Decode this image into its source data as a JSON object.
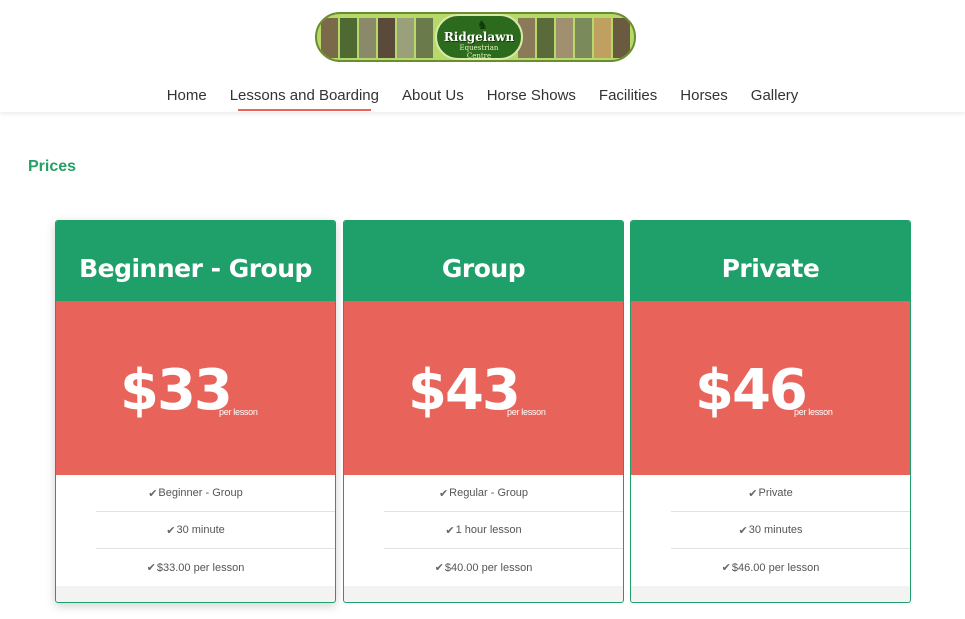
{
  "logo": {
    "name": "Ridgelawn",
    "subtitle_line1": "Equestrian",
    "subtitle_line2": "Centre"
  },
  "nav": {
    "items": [
      {
        "label": "Home"
      },
      {
        "label": "Lessons and Boarding",
        "active": true
      },
      {
        "label": "About Us"
      },
      {
        "label": "Horse Shows"
      },
      {
        "label": "Facilities"
      },
      {
        "label": "Horses"
      },
      {
        "label": "Gallery"
      }
    ]
  },
  "page": {
    "heading": "Prices"
  },
  "cards": [
    {
      "title": "Beginner - Group",
      "price": "$33",
      "unit": "per lesson",
      "features": [
        "Beginner - Group",
        "30 minute",
        "$33.00 per lesson"
      ]
    },
    {
      "title": "Group",
      "price": "$43",
      "unit": "per lesson",
      "features": [
        "Regular - Group",
        "1 hour lesson",
        "$40.00 per lesson"
      ]
    },
    {
      "title": "Private",
      "price": "$46",
      "unit": "per lesson",
      "features": [
        "Private",
        "30 minutes",
        "$46.00 per lesson"
      ]
    }
  ],
  "colors": {
    "green": "#1fa06a",
    "coral": "#e8645a",
    "heading_green": "#27a065"
  },
  "icons": {
    "check": "check-icon"
  }
}
